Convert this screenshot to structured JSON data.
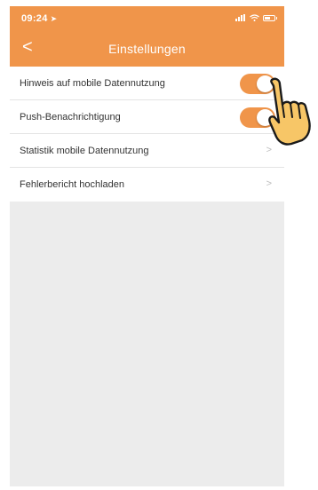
{
  "status_bar": {
    "time": "09:24",
    "location_icon": "location-arrow-icon",
    "icons": [
      "signal-icon",
      "wifi-icon",
      "battery-icon"
    ]
  },
  "nav": {
    "back_icon": "chevron-left-icon",
    "back_glyph": "<",
    "title": "Einstellungen"
  },
  "settings": {
    "items": [
      {
        "label": "Hinweis auf mobile Datennutzung",
        "control": "toggle",
        "on": true
      },
      {
        "label": "Push-Benachrichtigung",
        "control": "toggle",
        "on": true
      },
      {
        "label": "Statistik mobile Datennutzung",
        "control": "chevron",
        "chevron_glyph": ">"
      },
      {
        "label": "Fehlerbericht hochladen",
        "control": "chevron",
        "chevron_glyph": ">"
      }
    ]
  },
  "overlay": {
    "pointer_icon": "tapping-hand-icon"
  },
  "colors": {
    "accent": "#f0954a",
    "background": "#ececec",
    "row_bg": "#ffffff",
    "text": "#333333",
    "chevron": "#bdbdbd"
  }
}
